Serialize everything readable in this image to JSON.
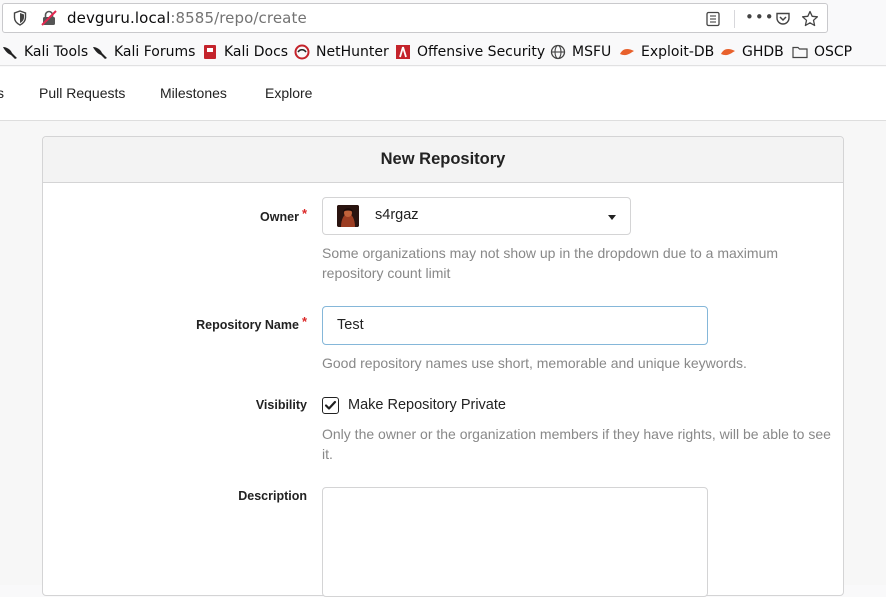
{
  "browser": {
    "url_host": "devguru.local",
    "url_path": ":8585/repo/create"
  },
  "bookmarks": [
    {
      "label": "Kali Tools",
      "icon": "kali-dragon-icon"
    },
    {
      "label": "Kali Forums",
      "icon": "kali-dragon-icon"
    },
    {
      "label": "Kali Docs",
      "icon": "kali-docs-icon"
    },
    {
      "label": "NetHunter",
      "icon": "nethunter-icon"
    },
    {
      "label": "Offensive Security",
      "icon": "offsec-icon"
    },
    {
      "label": "MSFU",
      "icon": "globe-icon"
    },
    {
      "label": "Exploit-DB",
      "icon": "exploitdb-icon"
    },
    {
      "label": "GHDB",
      "icon": "ghdb-icon"
    },
    {
      "label": "OSCP",
      "icon": "folder-icon"
    }
  ],
  "nav": {
    "partial": "s",
    "pull_requests": "Pull Requests",
    "milestones": "Milestones",
    "explore": "Explore"
  },
  "form": {
    "title": "New Repository",
    "owner_label": "Owner",
    "owner_value": "s4rgaz",
    "owner_help_1": "Some organizations may not show up in the dropdown due to a maximum",
    "owner_help_2": "repository count limit",
    "name_label": "Repository Name",
    "name_value": "Test",
    "name_help": "Good repository names use short, memorable and unique keywords.",
    "visibility_label": "Visibility",
    "visibility_checkbox": "Make Repository Private",
    "visibility_checked": true,
    "visibility_help_1": "Only the owner or the organization members if they have rights, will be able to see",
    "visibility_help_2": "it.",
    "description_label": "Description",
    "required_mark": "*"
  }
}
